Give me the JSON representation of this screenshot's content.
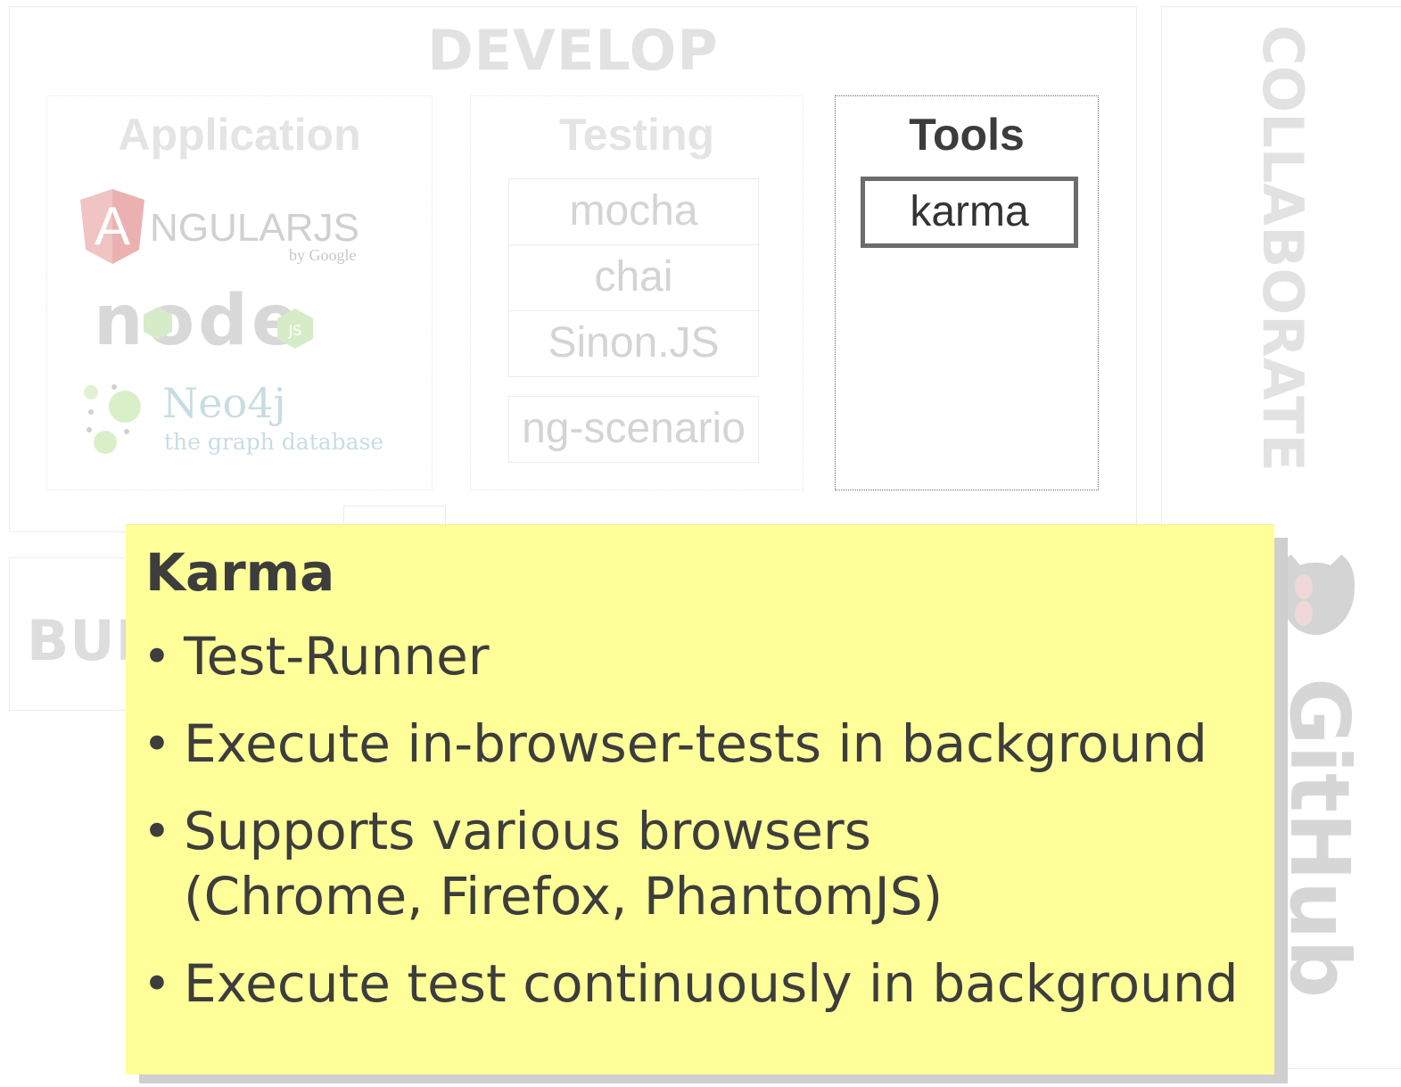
{
  "develop": {
    "title": "DEVELOP",
    "application": {
      "title": "Application",
      "logos": {
        "angular": {
          "text": "NGULARJS",
          "initial": "A",
          "byline": "by Google",
          "icon": "angularjs-logo"
        },
        "node": {
          "text": "node",
          "badge": "JS",
          "icon": "nodejs-logo"
        },
        "neo4j": {
          "name": "Neo4j",
          "tagline": "the graph database",
          "icon": "neo4j-logo"
        }
      }
    },
    "testing": {
      "title": "Testing",
      "items": [
        "mocha",
        "chai",
        "Sinon.JS",
        "ng-scenario"
      ]
    },
    "tools": {
      "title": "Tools",
      "items": [
        "karma"
      ]
    }
  },
  "build": {
    "title": "BUI"
  },
  "collaborate": {
    "title": "COLLABORATE",
    "logo": {
      "text": "GitHub",
      "icon": "github-octocat-logo"
    }
  },
  "note": {
    "title": "Karma",
    "bullets": [
      "Test-Runner",
      "Execute in-browser-tests in background",
      "Supports various browsers\n(Chrome, Firefox, PhantomJS)",
      "Execute test continuously in background"
    ]
  },
  "colors": {
    "note_background": "#ffff99",
    "faded_text": "#e2e2e2",
    "active_text": "#3d3d3d"
  }
}
